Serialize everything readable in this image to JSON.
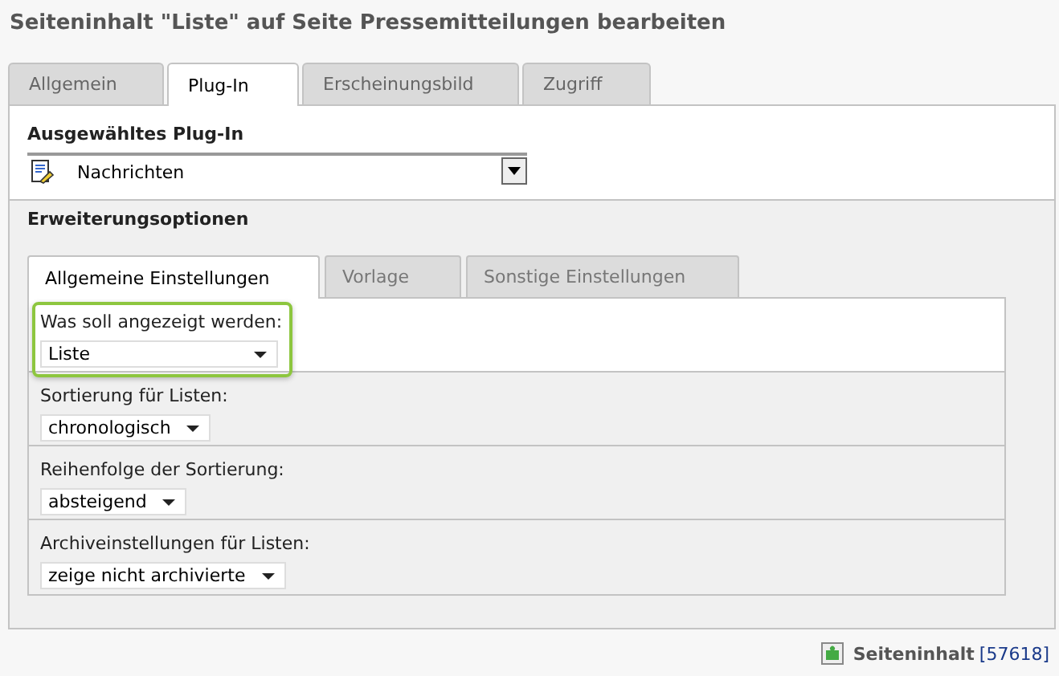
{
  "title": "Seiteninhalt \"Liste\" auf Seite Pressemitteilungen bearbeiten",
  "tabs": [
    {
      "label": "Allgemein",
      "selected": false
    },
    {
      "label": "Plug-In",
      "selected": true
    },
    {
      "label": "Erscheinungsbild",
      "selected": false
    },
    {
      "label": "Zugriff",
      "selected": false
    }
  ],
  "plugin": {
    "label": "Ausgewähltes Plug-In",
    "value": "Nachrichten"
  },
  "extension": {
    "label": "Erweiterungsoptionen"
  },
  "subtabs": [
    {
      "label": "Allgemeine Einstellungen",
      "selected": true
    },
    {
      "label": "Vorlage",
      "selected": false
    },
    {
      "label": "Sonstige Einstellungen",
      "selected": false
    }
  ],
  "fields": [
    {
      "label": "Was soll angezeigt werden:",
      "value": "Liste",
      "highlighted": true
    },
    {
      "label": "Sortierung für Listen:",
      "value": "chronologisch",
      "highlighted": false
    },
    {
      "label": "Reihenfolge der Sortierung:",
      "value": "absteigend",
      "highlighted": false
    },
    {
      "label": "Archiveinstellungen für Listen:",
      "value": "zeige nicht archivierte",
      "highlighted": false
    }
  ],
  "footer": {
    "record_type": "Seiteninhalt",
    "record_id": "[57618]"
  }
}
